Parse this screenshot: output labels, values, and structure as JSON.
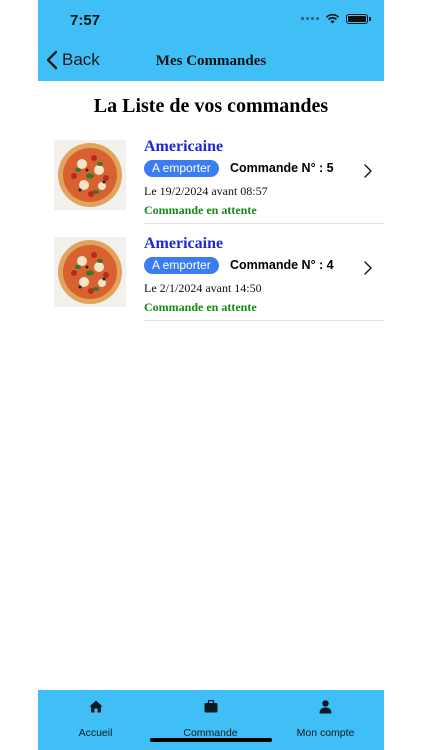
{
  "status": {
    "time": "7:57"
  },
  "nav": {
    "back_label": "Back",
    "title": "Mes Commandes"
  },
  "page": {
    "title": "La Liste de vos commandes"
  },
  "orders": [
    {
      "name": "Americaine",
      "badge": "A emporter",
      "number": "Commande N° : 5",
      "date": "Le 19/2/2024 avant 08:57",
      "status": "Commande en attente"
    },
    {
      "name": "Americaine",
      "badge": "A emporter",
      "number": "Commande N° : 4",
      "date": "Le 2/1/2024 avant 14:50",
      "status": "Commande en attente"
    }
  ],
  "tabs": [
    {
      "label": "Accueil",
      "icon": "home-icon"
    },
    {
      "label": "Commande",
      "icon": "bag-icon"
    },
    {
      "label": "Mon compte",
      "icon": "user-icon"
    }
  ],
  "colors": {
    "header": "#3fbff5",
    "badge": "#3b7df0",
    "item_name": "#1a2bd6",
    "status_text": "#138a13"
  }
}
